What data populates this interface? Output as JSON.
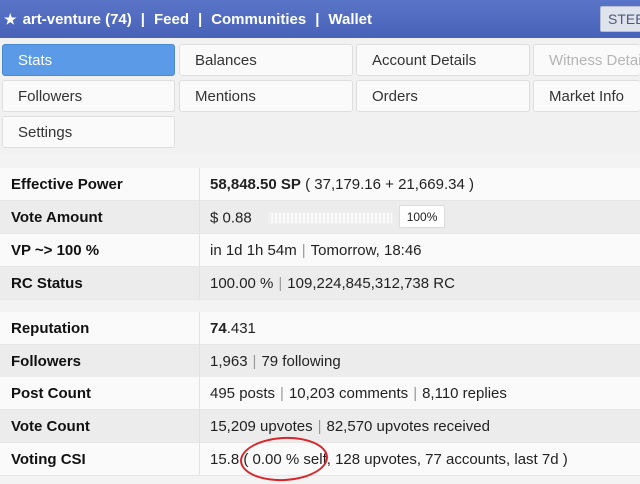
{
  "topbar": {
    "star": "★",
    "account": "art-venture (74)",
    "links": [
      "Feed",
      "Communities",
      "Wallet"
    ],
    "separator": "|",
    "steem_label": "STEE"
  },
  "tabs": [
    {
      "label": "Stats",
      "state": "active"
    },
    {
      "label": "Balances",
      "state": "normal"
    },
    {
      "label": "Account Details",
      "state": "normal"
    },
    {
      "label": "Witness Details",
      "state": "disabled"
    },
    {
      "label": "Followers",
      "state": "normal"
    },
    {
      "label": "Mentions",
      "state": "normal"
    },
    {
      "label": "Orders",
      "state": "normal"
    },
    {
      "label": "Market Info",
      "state": "normal"
    },
    {
      "label": "Settings",
      "state": "normal"
    }
  ],
  "stats": {
    "effective_power": {
      "label": "Effective Power",
      "sp": "58,848.50 SP",
      "detail": "( 37,179.16 + 21,669.34 )"
    },
    "vote_amount": {
      "label": "Vote Amount",
      "value": "$ 0.88",
      "percent_label": "100%",
      "percent": 100
    },
    "vp": {
      "label": "VP ~> 100 %",
      "eta": "in 1d 1h 54m",
      "when": "Tomorrow, 18:46"
    },
    "rc_status": {
      "label": "RC Status",
      "percent": "100.00 %",
      "rc": "109,224,845,312,738 RC"
    },
    "reputation": {
      "label": "Reputation",
      "whole": "74",
      "fraction": ".431"
    },
    "followers": {
      "label": "Followers",
      "count": "1,963",
      "following": "79 following"
    },
    "post_count": {
      "label": "Post Count",
      "posts": "495 posts",
      "comments": "10,203 comments",
      "replies": "8,110 replies"
    },
    "vote_count": {
      "label": "Vote Count",
      "upvotes": "15,209 upvotes",
      "received": "82,570 upvotes received"
    },
    "voting_csi": {
      "label": "Voting CSI",
      "value": "15.8",
      "detail": "( 0.00 % self, 128 upvotes, 77 accounts, last 7d )"
    }
  },
  "colors": {
    "topbar": "#4f69bf",
    "active_tab": "#5a9ae6",
    "annotation_circle": "#d9252a"
  },
  "icons": {
    "star": "star-icon"
  }
}
